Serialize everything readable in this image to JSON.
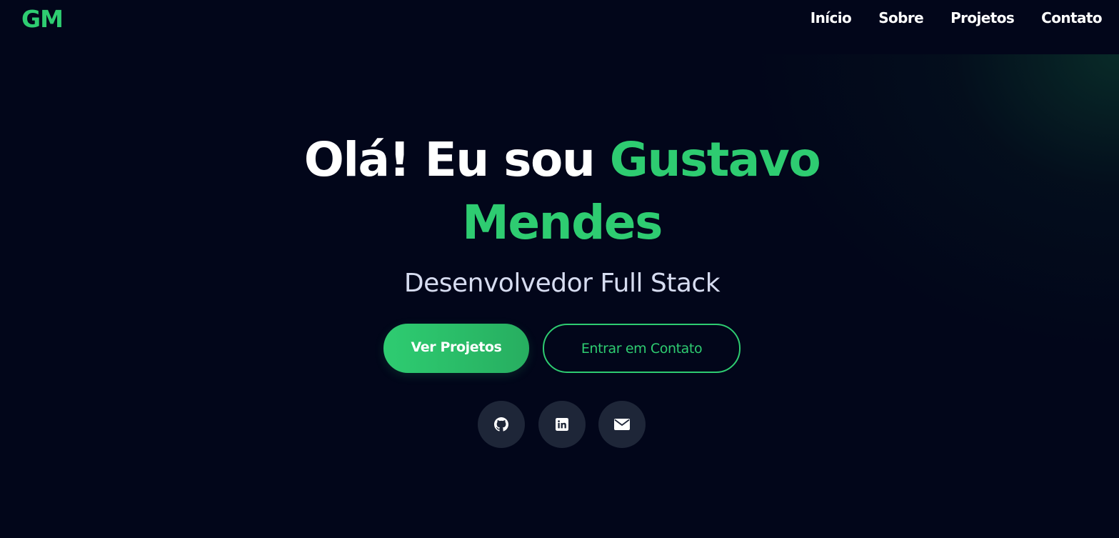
{
  "nav": {
    "logo": "GM",
    "links": [
      "Início",
      "Sobre",
      "Projetos",
      "Contato"
    ]
  },
  "hero": {
    "greeting": "Olá! Eu sou ",
    "name_first": "Gustavo",
    "name_last": "Mendes",
    "role": "Desenvolvedor Full Stack",
    "primary_button": "Ver Projetos",
    "secondary_button": "Entrar em Contato"
  },
  "social": [
    {
      "icon": "github-icon"
    },
    {
      "icon": "linkedin-icon"
    },
    {
      "icon": "email-icon"
    }
  ],
  "colors": {
    "background": "#02061a",
    "accent": "#2ecc71",
    "social_bg": "#1e2638",
    "subtitle": "#d6dcf0"
  }
}
